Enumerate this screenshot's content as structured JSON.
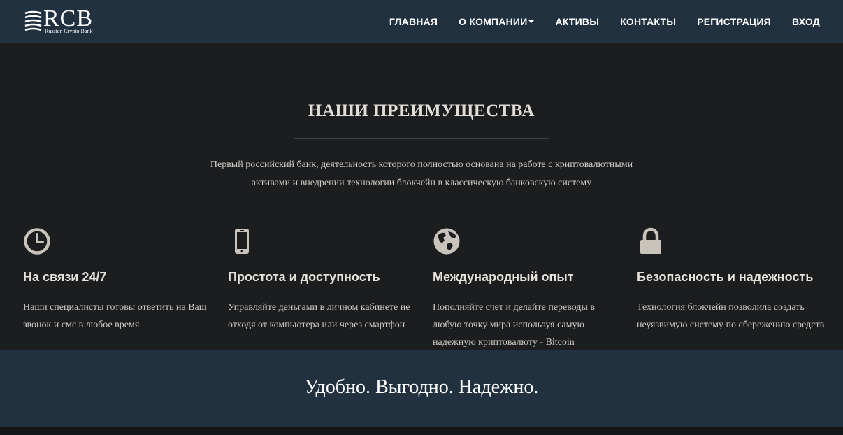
{
  "header": {
    "logo": {
      "text": "RCB",
      "subtitle": "Russian Crypto Bank"
    },
    "nav": [
      {
        "label": "ГЛАВНАЯ"
      },
      {
        "label": "О КОМПАНИИ",
        "dropdown": true
      },
      {
        "label": "АКТИВЫ"
      },
      {
        "label": "КОНТАКТЫ"
      },
      {
        "label": "РЕГИСТРАЦИЯ"
      },
      {
        "label": "ВХОД"
      }
    ]
  },
  "advantages": {
    "title": "НАШИ ПРЕИМУЩЕСТВА",
    "description_line1": "Первый российский банк, деятельность которого полностью основана на работе с криптовалютными",
    "description_line2": "активами и внедрении технологии блокчейн в классическую банковскую систему",
    "features": [
      {
        "icon": "clock-icon",
        "title": "На связи 24/7",
        "text": "Наши специалисты готовы ответить на Ваш звонок и смс в любое время"
      },
      {
        "icon": "smartphone-icon",
        "title": "Простота и доступность",
        "text": "Управляйте деньгами в личном кабинете не отходя от компьютера или через смартфон"
      },
      {
        "icon": "globe-icon",
        "title": "Международный опыт",
        "text": "Пополняйте счет и делайте переводы в любую точку мира используя самую надежную криптовалюту - Bitcoin"
      },
      {
        "icon": "lock-icon",
        "title": "Безопасность и надежность",
        "text": "Технология блокчейн позволила создать неуязвимую систему по сбережению средств"
      }
    ]
  },
  "banner": {
    "text": "Удобно. Выгодно. Надежно."
  },
  "colors": {
    "navbar_bg": "#213140",
    "section_bg": "#1b1d1f",
    "icon": "#c9c3bb"
  }
}
